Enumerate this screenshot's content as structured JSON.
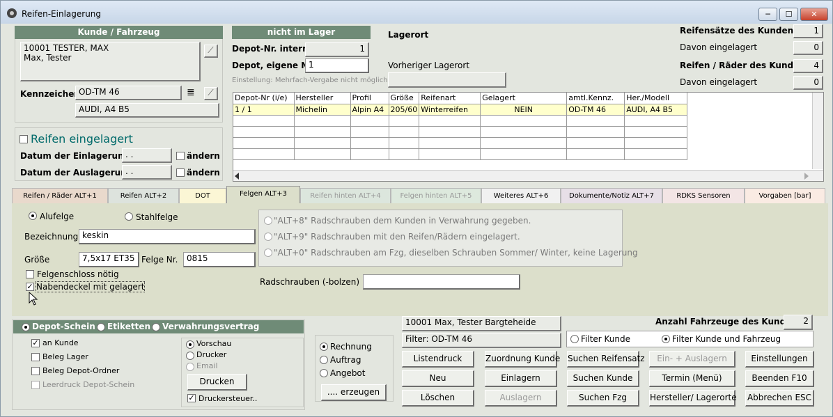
{
  "window": {
    "title": "Reifen-Einlagerung",
    "min": "─",
    "max": "☐",
    "close": "✕"
  },
  "kunde": {
    "header": "Kunde / Fahrzeug",
    "line1": "10001 TESTER, MAX",
    "line2": "Max, Tester",
    "kennzeichen_label": "Kennzeichen",
    "kennzeichen": "OD-TM 46",
    "fahrzeug": "AUDI, A4 B5"
  },
  "lager": {
    "status": "nicht im Lager",
    "depot_intern_label": "Depot-Nr. intern",
    "depot_intern": "1",
    "depot_eigen_label": "Depot, eigene Nr.",
    "depot_eigen": "1",
    "hint": "Einstellung: Mehrfach-Vergabe nicht möglich",
    "lagerort_label": "Lagerort",
    "vorheriger_label": "Vorheriger Lagerort"
  },
  "stats": {
    "saetze_label": "Reifensätze des Kunden",
    "saetze": "1",
    "saetze_eing_label": "Davon eingelagert",
    "saetze_eing": "0",
    "raeder_label": "Reifen / Räder des Kunden",
    "raeder": "4",
    "raeder_eing_label": "Davon eingelagert",
    "raeder_eing": "0"
  },
  "einlagerung": {
    "title": "Reifen eingelagert",
    "datum_ein_label": "Datum der Einlagerung",
    "datum_ein": ". .",
    "datum_aus_label": "Datum der Auslagerung",
    "datum_aus": ". .",
    "aendern": "ändern"
  },
  "table": {
    "columns": [
      "Depot-Nr (i/e)",
      "Hersteller",
      "Profil",
      "Größe",
      "Reifenart",
      "Gelagert",
      "amtl.Kennz.",
      "Her./Modell"
    ],
    "rows": [
      [
        "1 / 1",
        "Michelin",
        "Alpin A4",
        "205/60",
        "Winterreifen",
        "NEIN",
        "OD-TM 46",
        "AUDI, A4 B5"
      ]
    ]
  },
  "tabs": [
    {
      "label": "Reifen / Räder ALT+1"
    },
    {
      "label": "Reifen ALT+2"
    },
    {
      "label": "DOT"
    },
    {
      "label": "Felgen ALT+3"
    },
    {
      "label": "Reifen hinten ALT+4"
    },
    {
      "label": "Felgen hinten ALT+5"
    },
    {
      "label": "Weiteres ALT+6"
    },
    {
      "label": "Dokumente/Notiz ALT+7"
    },
    {
      "label": "RDKS Sensoren"
    },
    {
      "label": "Vorgaben [bar]"
    }
  ],
  "felgen": {
    "alu": "Alufelge",
    "stahl": "Stahlfelge",
    "bez_label": "Bezeichnung",
    "bez": "keskin",
    "groesse_label": "Größe",
    "groesse": "7,5x17 ET35",
    "felgenr_label": "Felge Nr.",
    "felgenr": "0815",
    "schloss": "Felgenschloss nötig",
    "naben": "Nabendeckel mit gelagert",
    "opt8": "\"ALT+8\" Radschrauben dem Kunden in Verwahrung gegeben.",
    "opt9": "\"ALT+9\" Radschrauben mit den Reifen/Rädern eingelagert.",
    "opt0": "\"ALT+0\" Radschrauben am Fzg, dieselben Schrauben Sommer/ Winter, keine Lagerung",
    "schrauben_label": "Radschrauben (-bolzen)",
    "schrauben": ""
  },
  "druck": {
    "depot": "Depot-Schein",
    "etiketten": "Etiketten",
    "vertrag": "Verwahrungsvertrag",
    "an_kunde": "an Kunde",
    "beleg_lager": "Beleg Lager",
    "beleg_ordner": "Beleg Depot-Ordner",
    "leerdruck": "Leerdruck Depot-Schein",
    "vorschau": "Vorschau",
    "drucker": "Drucker",
    "email": "Email",
    "drucken": "Drucken",
    "steuer": "Druckersteuer.."
  },
  "rechnung": {
    "rechnung": "Rechnung",
    "auftrag": "Auftrag",
    "angebot": "Angebot",
    "erzeugen": ".... erzeugen"
  },
  "kunde_info": {
    "name": "10001 Max, Tester Bargteheide",
    "filter": "Filter: OD-TM 46",
    "anzahl_label": "Anzahl Fahrzeuge des Kunden",
    "anzahl": "2",
    "filter_kunde": "Filter Kunde",
    "filter_kf": "Filter Kunde und Fahrzeug"
  },
  "buttons": {
    "listendruck": "Listendruck",
    "zuordnung": "Zuordnung Kunde",
    "suchen_satz": "Suchen Reifensatz",
    "ein_aus": "Ein- + Auslagern",
    "einstellungen": "Einstellungen",
    "neu": "Neu",
    "einlagern": "Einlagern",
    "suchen_kunde": "Suchen Kunde",
    "termin": "Termin (Menü)",
    "beenden": "Beenden F10",
    "loeschen": "Löschen",
    "auslagern": "Auslagern",
    "suchen_fzg": "Suchen Fzg",
    "hersteller": "Hersteller/ Lagerorte",
    "abbrechen": "Abbrechen ESC"
  },
  "colors": {
    "group_header": "#6f8b77",
    "accent_title": "#006a6a",
    "selected_row": "#ffffcc"
  }
}
